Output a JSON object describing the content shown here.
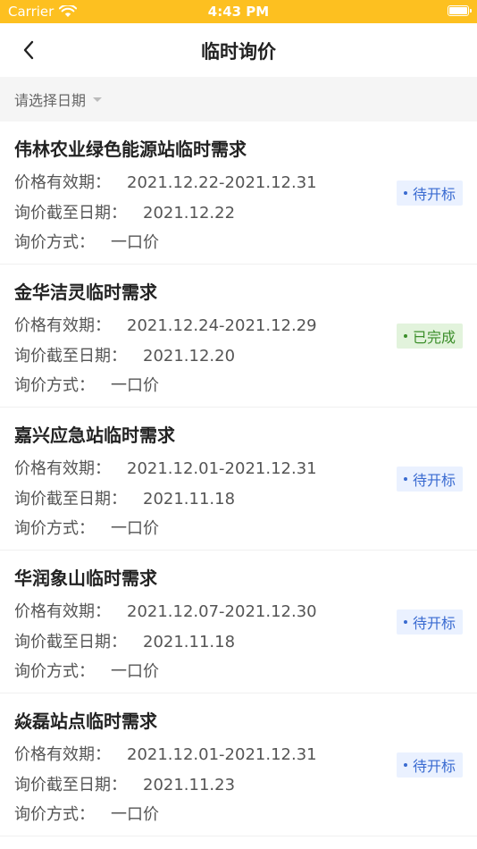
{
  "status_bar": {
    "carrier": "Carrier",
    "time": "4:43 PM",
    "color": "#FDC020"
  },
  "nav": {
    "title": "临时询价",
    "back_icon": "chevron-left-icon"
  },
  "filter": {
    "date_label": "请选择日期"
  },
  "labels": {
    "validity": "价格有效期：",
    "deadline": "询价截至日期：",
    "method": "询价方式："
  },
  "inquiries": [
    {
      "title": "伟林农业绿色能源站临时需求",
      "validity": "2021.12.22-2021.12.31",
      "deadline": "2021.12.22",
      "method": "一口价",
      "status": "待开标",
      "status_type": "pending"
    },
    {
      "title": "金华洁灵临时需求",
      "validity": "2021.12.24-2021.12.29",
      "deadline": "2021.12.20",
      "method": "一口价",
      "status": "已完成",
      "status_type": "done"
    },
    {
      "title": "嘉兴应急站临时需求",
      "validity": "2021.12.01-2021.12.31",
      "deadline": "2021.11.18",
      "method": "一口价",
      "status": "待开标",
      "status_type": "pending"
    },
    {
      "title": "华润象山临时需求",
      "validity": "2021.12.07-2021.12.30",
      "deadline": "2021.11.18",
      "method": "一口价",
      "status": "待开标",
      "status_type": "pending"
    },
    {
      "title": "焱磊站点临时需求",
      "validity": "2021.12.01-2021.12.31",
      "deadline": "2021.11.23",
      "method": "一口价",
      "status": "待开标",
      "status_type": "pending"
    }
  ],
  "colors": {
    "pending_text": "#3A6BD1",
    "pending_bg": "#EAF1FF",
    "done_text": "#3B8E2A",
    "done_bg": "#E2F3DC"
  }
}
